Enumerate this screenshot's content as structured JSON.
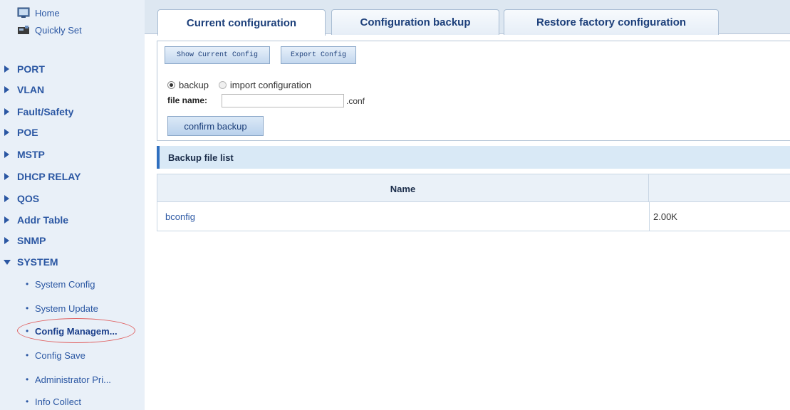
{
  "sidebar": {
    "top_items": [
      {
        "label": "Home",
        "icon": "home-icon"
      },
      {
        "label": "Quickly Set",
        "icon": "quick-set-icon"
      }
    ],
    "groups": [
      {
        "label": "PORT"
      },
      {
        "label": "VLAN"
      },
      {
        "label": "Fault/Safety"
      },
      {
        "label": "POE"
      },
      {
        "label": "MSTP"
      },
      {
        "label": "DHCP RELAY"
      },
      {
        "label": "QOS"
      },
      {
        "label": "Addr Table"
      },
      {
        "label": "SNMP"
      },
      {
        "label": "SYSTEM"
      }
    ],
    "system_items": [
      {
        "label": "System Config"
      },
      {
        "label": "System Update"
      },
      {
        "label": "Config Managem..."
      },
      {
        "label": "Config Save"
      },
      {
        "label": "Administrator Pri..."
      },
      {
        "label": "Info Collect"
      }
    ]
  },
  "tabs": [
    {
      "label": "Current configuration"
    },
    {
      "label": "Configuration backup"
    },
    {
      "label": "Restore factory configuration"
    }
  ],
  "config": {
    "show_btn": "Show Current Config",
    "export_btn": "Export Config",
    "radio_backup": "backup",
    "radio_import": "import configuration",
    "file_label": "file name:",
    "file_value": "",
    "file_ext": ".conf",
    "confirm_btn": "confirm backup"
  },
  "backup_list": {
    "title": "Backup file list",
    "col_name": "Name",
    "rows": [
      {
        "name": "bconfig",
        "size": "2.00K"
      }
    ]
  },
  "colors": {
    "accent": "#2b57a3",
    "sidebar_bg": "#e9f0f8",
    "highlight": "#e06060"
  }
}
